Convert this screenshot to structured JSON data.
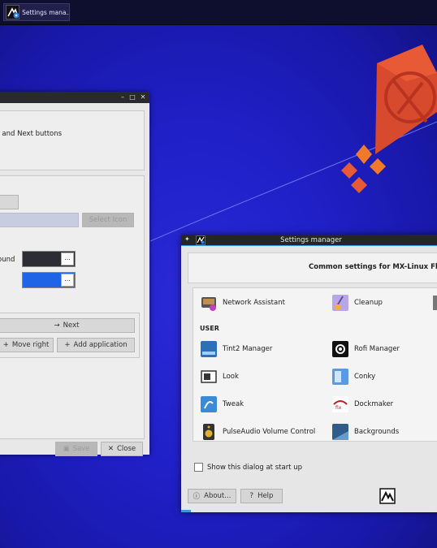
{
  "taskbar": {
    "task_label": "Settings mana..."
  },
  "window1": {
    "desc_text": ", and Next buttons",
    "label_background": "ound",
    "label_foreground": "",
    "swatch_dark": "#2c2c34",
    "swatch_blue": "#1f63e6",
    "swatch_btn": "...",
    "btn_next": "Next",
    "btn_move_right": "Move right",
    "btn_add_app": "Add application",
    "btn_save": "Save",
    "btn_close": "Close",
    "btn_select": "Select Icon"
  },
  "window2": {
    "title": "Settings manager",
    "header": "Common settings for MX-Linux Flu",
    "top_items": [
      {
        "label": "Network Assistant",
        "icon": "network-assistant-icon"
      },
      {
        "label": "Cleanup",
        "icon": "cleanup-icon"
      }
    ],
    "section_user": "USER",
    "items_left": [
      {
        "label": "Tint2 Manager",
        "icon": "tint2-icon"
      },
      {
        "label": "Look",
        "icon": "look-icon"
      },
      {
        "label": "Tweak",
        "icon": "tweak-icon"
      },
      {
        "label": "PulseAudio Volume Control",
        "icon": "speaker-icon"
      }
    ],
    "items_right": [
      {
        "label": "Rofi Manager",
        "icon": "rofi-icon"
      },
      {
        "label": "Conky",
        "icon": "conky-icon"
      },
      {
        "label": "Dockmaker",
        "icon": "dockmaker-icon"
      },
      {
        "label": "Backgrounds",
        "icon": "backgrounds-icon"
      }
    ],
    "show_dialog": "Show this dialog at start up",
    "btn_about": "About...",
    "btn_help": "Help"
  },
  "colors": {
    "accent": "#3a9ad8",
    "kite_red": "#d84a2e",
    "kite_orange": "#f07a2a"
  }
}
